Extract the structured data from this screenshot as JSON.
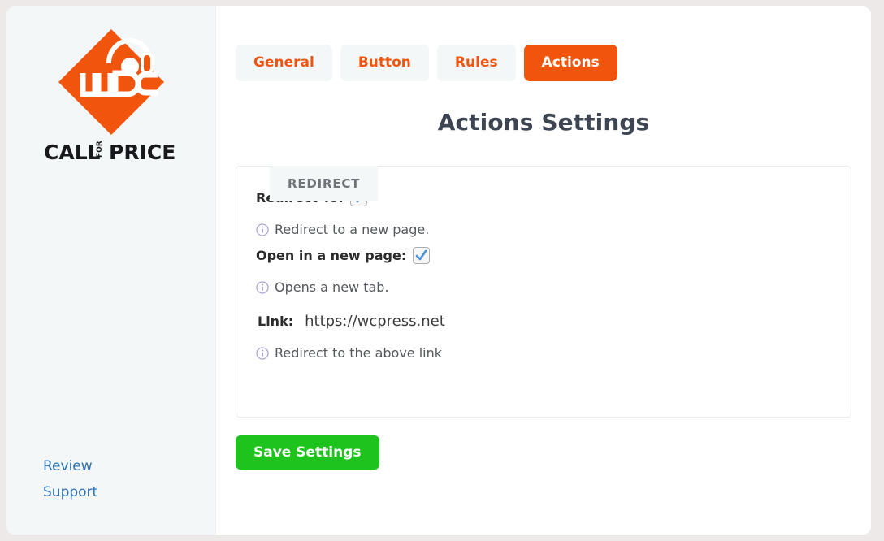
{
  "brand": {
    "logo_icon": "call-for-price-logo-icon",
    "wordmark_main_left": "CALL",
    "wordmark_small": "FOR",
    "wordmark_main_right": "PRICE",
    "accent_color": "#f1540c"
  },
  "sidebar": {
    "links": [
      {
        "label": "Review"
      },
      {
        "label": "Support"
      }
    ],
    "link_color": "#2f72b0"
  },
  "tabs": [
    {
      "label": "General",
      "active": false
    },
    {
      "label": "Button",
      "active": false
    },
    {
      "label": "Rules",
      "active": false
    },
    {
      "label": "Actions",
      "active": true
    }
  ],
  "main": {
    "title": "Actions Settings",
    "panel_tab_label": "REDIRECT"
  },
  "fields": {
    "redirect_to": {
      "label": "Redirect To:",
      "checked": true,
      "hint": "Redirect to a new page.",
      "hint_icon": "info-icon"
    },
    "open_new_page": {
      "label": "Open in a new page:",
      "checked": true,
      "hint": "Opens a new tab.",
      "hint_icon": "info-icon"
    },
    "link": {
      "label": "Link:",
      "value": "https://wcpress.net",
      "placeholder": "https://",
      "hint": "Redirect to the above link",
      "hint_icon": "info-icon"
    }
  },
  "footer": {
    "save_label": "Save Settings",
    "save_color": "#1ec31e"
  }
}
